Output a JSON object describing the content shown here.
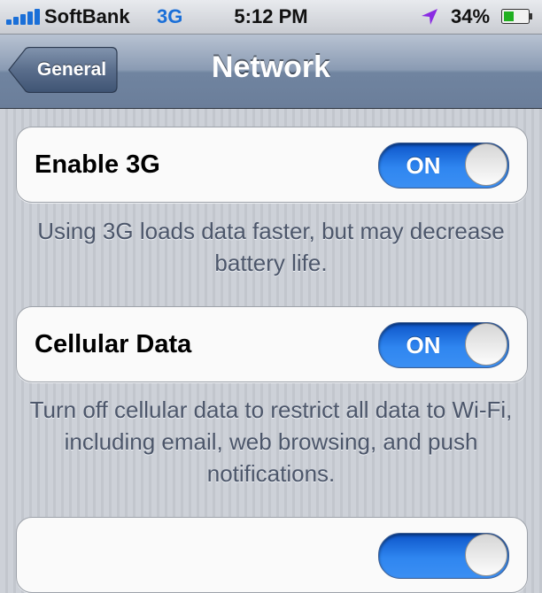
{
  "status_bar": {
    "carrier": "SoftBank",
    "network_type": "3G",
    "time": "5:12 PM",
    "battery_percent": "34%",
    "signal_icon": "signal-bars-icon",
    "location_icon": "location-arrow-icon",
    "battery_icon": "battery-icon",
    "network_color": "#1a6fd8",
    "location_color": "#8a2be2"
  },
  "nav": {
    "back_label": "General",
    "title": "Network"
  },
  "settings": {
    "enable_3g": {
      "label": "Enable 3G",
      "toggle": "ON",
      "note": "Using 3G loads data faster, but may decrease battery life."
    },
    "cellular_data": {
      "label": "Cellular Data",
      "toggle": "ON",
      "note": "Turn off cellular data to restrict all data to Wi-Fi, including email, web browsing, and push notifications."
    }
  },
  "colors": {
    "toggle_on": "#2f86f0",
    "nav_bar": "#8a9bb3"
  }
}
